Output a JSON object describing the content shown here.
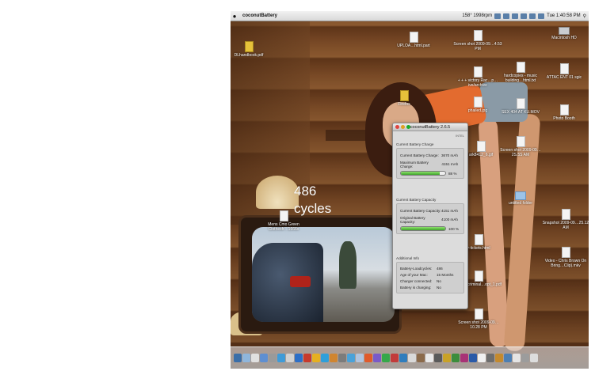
{
  "annotation": {
    "value": "486",
    "unit": "cycles"
  },
  "menubar": {
    "apple": "",
    "app_name": "coconutBattery",
    "menus": [],
    "status": "158° 1998rpm",
    "clock": "Tue 1:40:58 PM"
  },
  "desktop_icons": [
    {
      "label": "DLhandbook.pdf",
      "kind": "pdf"
    },
    {
      "label": "UPLOA…html.part",
      "kind": "doc"
    },
    {
      "label": "Screen shot 2009-09…4.53 PM",
      "kind": "doc"
    },
    {
      "label": "Macintosh HD",
      "kind": "hd"
    },
    {
      "label": "+ + + victory Rac…p…ive/archive",
      "kind": "doc"
    },
    {
      "label": "hardcopies - music building…html.txt",
      "kind": "doc"
    },
    {
      "label": "ATTAC ENT 01 sgic",
      "kind": "doc"
    },
    {
      "label": "Firefox",
      "kind": "app"
    },
    {
      "label": "phailed.jpg",
      "kind": "doc"
    },
    {
      "label": "SEX 404 AT KU.MOV",
      "kind": "doc"
    },
    {
      "label": "Photo Booth",
      "kind": "app"
    },
    {
      "label": "ark8412_6.gif",
      "kind": "doc"
    },
    {
      "label": "Screen shot 2009-09…2S.5S AM",
      "kind": "doc"
    },
    {
      "label": "untitled folder",
      "kind": "folder"
    },
    {
      "label": "Mens Cmo Green Clothesfr…1666x",
      "kind": "doc"
    },
    {
      "label": "Snapshot 2009-09…25.12 AM",
      "kind": "doc"
    },
    {
      "label": "y-tickets.html",
      "kind": "doc"
    },
    {
      "label": "Video - Chris Brown On Bring…Clip).mkv",
      "kind": "doc"
    },
    {
      "label": "traffic, criminal…opt_1.pdf",
      "kind": "doc"
    },
    {
      "label": "Screen shot 2009-09…10.28 PM",
      "kind": "doc"
    }
  ],
  "window": {
    "title": "coconutBattery 2.6.5",
    "arch": "INTEL",
    "charge": {
      "heading": "Current Battery Charge",
      "current_label": "Current Battery Charge:",
      "current_value": "3670 mAh",
      "max_label": "Maximum Battery Charge:",
      "max_value": "4151 mAh",
      "percent": 88,
      "percent_label": "88 %"
    },
    "capacity": {
      "heading": "Current Battery Capacity",
      "current_label": "Current Battery Capacity:",
      "current_value": "4151 mAh",
      "original_label": "Original Battery Capacity:",
      "original_value": "4100 mAh",
      "percent": 100,
      "percent_label": "100 %"
    },
    "info": {
      "heading": "Additional Info",
      "rows": [
        {
          "label": "Battery-Loadcycles:",
          "value": "486"
        },
        {
          "label": "Age of your Mac:",
          "value": "15 Months"
        },
        {
          "label": "Charger connected:",
          "value": "No"
        },
        {
          "label": "Battery is charging:",
          "value": "No"
        }
      ]
    },
    "colors": {
      "bar_fill": "#4cb535",
      "close": "#e0443e",
      "minimize": "#dea123",
      "zoom": "#1aab29"
    }
  }
}
